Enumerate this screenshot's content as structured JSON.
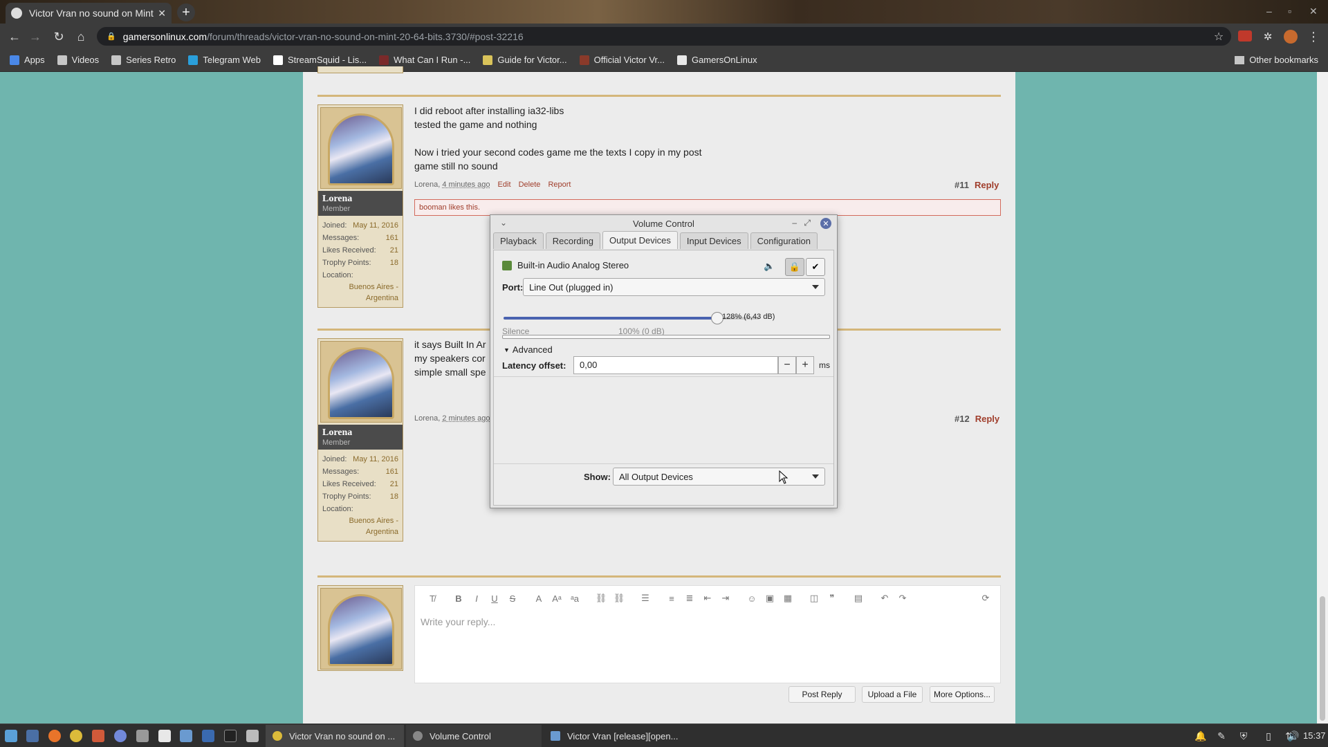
{
  "browser": {
    "tab_title": "Victor Vran no sound on Mint",
    "tab_close": "✕",
    "new_tab": "+",
    "url_host": "gamersonlinux.com",
    "url_path": "/forum/threads/victor-vran-no-sound-on-mint-20-64-bits.3730/#post-32216",
    "bookmarks": [
      {
        "label": "Apps",
        "color": "#4a88e8"
      },
      {
        "label": "Videos",
        "color": "#c6c6c6"
      },
      {
        "label": "Series Retro",
        "color": "#c6c6c6"
      },
      {
        "label": "Telegram Web",
        "color": "#2a9fdb"
      },
      {
        "label": "StreamSquid - Lis...",
        "color": "#ffffff"
      },
      {
        "label": "What Can I Run -...",
        "color": "#7a2a2a"
      },
      {
        "label": "Guide for Victor...",
        "color": "#d9c35a"
      },
      {
        "label": "Official Victor Vr...",
        "color": "#8a3a2a"
      },
      {
        "label": "GamersOnLinux",
        "color": "#e8e8e8"
      }
    ],
    "other_bookmarks": "Other bookmarks"
  },
  "posts": [
    {
      "user": {
        "name": "Lorena",
        "role": "Member",
        "joined_label": "Joined:",
        "joined": "May 11, 2016",
        "messages_label": "Messages:",
        "messages": "161",
        "likes_label": "Likes Received:",
        "likes": "21",
        "trophy_label": "Trophy Points:",
        "trophy": "18",
        "location_label": "Location:",
        "location_line1": "Buenos Aires -",
        "location_line2": "Argentina"
      },
      "lines": [
        "I did reboot after installing ia32-libs",
        "tested the game and nothing",
        "",
        "Now i tried your second codes game me the texts I copy in my post",
        "game still no sound"
      ],
      "meta_author": "Lorena,",
      "meta_time": "4 minutes ago",
      "edit": "Edit",
      "delete": "Delete",
      "report": "Report",
      "number": "#11",
      "reply": "Reply",
      "likes_text": "booman likes this."
    },
    {
      "user": {
        "name": "Lorena",
        "role": "Member",
        "joined_label": "Joined:",
        "joined": "May 11, 2016",
        "messages_label": "Messages:",
        "messages": "161",
        "likes_label": "Likes Received:",
        "likes": "21",
        "trophy_label": "Trophy Points:",
        "trophy": "18",
        "location_label": "Location:",
        "location_line1": "Buenos Aires -",
        "location_line2": "Argentina"
      },
      "lines": [
        "it says Built In Ar",
        "my speakers cor",
        "simple small spe"
      ],
      "meta_author": "Lorena,",
      "meta_time": "2 minutes ago",
      "number": "#12",
      "reply": "Reply"
    }
  ],
  "editor": {
    "placeholder": "Write your reply...",
    "post_reply": "Post Reply",
    "upload": "Upload a File",
    "more": "More Options..."
  },
  "dialog": {
    "title": "Volume Control",
    "tabs": [
      "Playback",
      "Recording",
      "Output Devices",
      "Input Devices",
      "Configuration"
    ],
    "active_tab": 2,
    "device_name": "Built-in Audio Analog Stereo",
    "port_label": "Port:",
    "port_value": "Line Out (plugged in)",
    "volume_fraction_of_track": 0.835,
    "volume_text": "128% (6,43 dB)",
    "silence_label": "Silence",
    "hundred_label": "100% (0 dB)",
    "advanced_label": "Advanced",
    "latency_label": "Latency offset:",
    "latency_value": "0,00",
    "latency_unit": "ms",
    "minus": "−",
    "plus": "+",
    "show_label": "Show:",
    "show_value": "All Output Devices"
  },
  "taskbar": {
    "windows": [
      "Victor Vran no sound on ...",
      "Volume Control",
      "Victor Vran [release][open..."
    ],
    "clock": "15:37"
  }
}
